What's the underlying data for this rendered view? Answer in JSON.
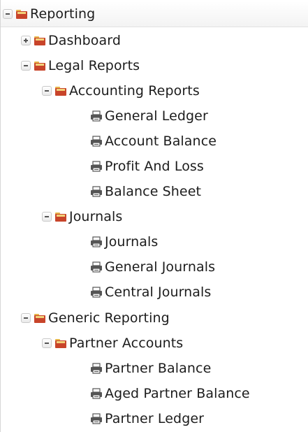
{
  "tree": {
    "items": [
      {
        "label": "Reporting",
        "type": "folder",
        "expanded": true,
        "icon": "folder-icon"
      },
      {
        "label": "Dashboard",
        "type": "folder",
        "expanded": false,
        "icon": "folder-icon"
      },
      {
        "label": "Legal Reports",
        "type": "folder",
        "expanded": true,
        "icon": "folder-icon"
      },
      {
        "label": "Accounting Reports",
        "type": "folder",
        "expanded": true,
        "icon": "folder-icon"
      },
      {
        "label": "General Ledger",
        "type": "report",
        "icon": "printer-icon"
      },
      {
        "label": "Account Balance",
        "type": "report",
        "icon": "printer-icon"
      },
      {
        "label": "Profit And Loss",
        "type": "report",
        "icon": "printer-icon"
      },
      {
        "label": "Balance Sheet",
        "type": "report",
        "icon": "printer-icon"
      },
      {
        "label": "Journals",
        "type": "folder",
        "expanded": true,
        "icon": "folder-icon"
      },
      {
        "label": "Journals",
        "type": "report",
        "icon": "printer-icon"
      },
      {
        "label": "General Journals",
        "type": "report",
        "icon": "printer-icon"
      },
      {
        "label": "Central Journals",
        "type": "report",
        "icon": "printer-icon"
      },
      {
        "label": "Generic Reporting",
        "type": "folder",
        "expanded": true,
        "icon": "folder-icon"
      },
      {
        "label": "Partner Accounts",
        "type": "folder",
        "expanded": true,
        "icon": "folder-icon"
      },
      {
        "label": "Partner Balance",
        "type": "report",
        "icon": "printer-icon"
      },
      {
        "label": "Aged Partner Balance",
        "type": "report",
        "icon": "printer-icon"
      },
      {
        "label": "Partner Ledger",
        "type": "report",
        "icon": "printer-icon"
      }
    ]
  },
  "colors": {
    "folder_body": "#c8442a",
    "folder_tab": "#e8b64a",
    "printer": "#555555"
  }
}
